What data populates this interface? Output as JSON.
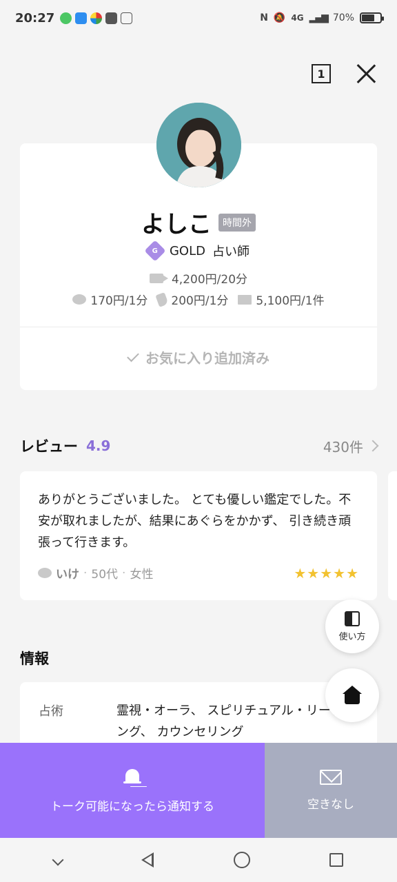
{
  "status_bar": {
    "time": "20:27",
    "network": "4G",
    "battery": "70%",
    "battery_level": 0.7
  },
  "header": {
    "tab_count": "1"
  },
  "profile": {
    "name": "よしこ",
    "status_badge": "時間外",
    "rank_icon_letter": "G",
    "rank_label": "GOLD",
    "role": "占い師",
    "video_price": "4,200円/20分",
    "chat_price": "170円/1分",
    "call_price": "200円/1分",
    "mail_price": "5,100円/1件",
    "favorite_label": "お気に入り追加済み"
  },
  "review": {
    "title": "レビュー",
    "score": "4.9",
    "count": "430件",
    "card": {
      "text": "ありがとうございました。 とても優しい鑑定でした。不安が取れましたが、結果にあぐらをかかず、 引き続き頑張って行きます。",
      "username": "いけ",
      "age": "50代",
      "gender": "女性",
      "rating": 5,
      "stars": "★★★★★"
    }
  },
  "info": {
    "title": "情報",
    "rows": [
      {
        "label": "占術",
        "value": "霊視・オーラ、 スピリチュアル・リーディング、 カウンセリング"
      }
    ]
  },
  "floating": {
    "guide_label": "使い方"
  },
  "actions": {
    "notify_label": "トーク可能になったら通知する",
    "unavailable_label": "空きなし"
  },
  "colors": {
    "accent": "#9a72fb",
    "score": "#8a6fd8",
    "star": "#f2c230",
    "disabled": "#a8adc0"
  }
}
